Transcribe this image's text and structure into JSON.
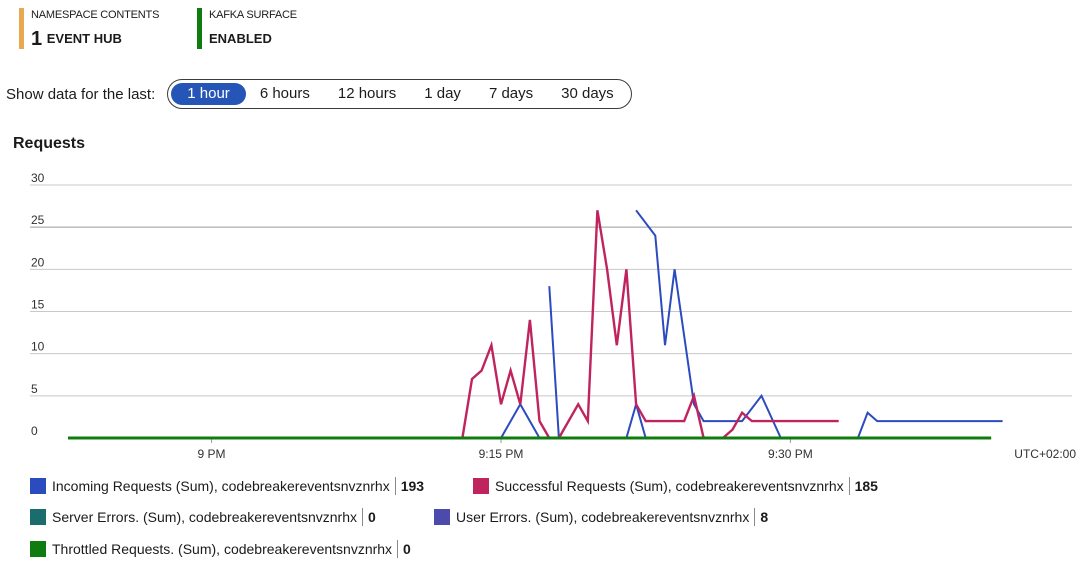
{
  "tiles": [
    {
      "label": "NAMESPACE CONTENTS",
      "number": "1",
      "value": "EVENT HUB",
      "color": "#e8a952"
    },
    {
      "label": "KAFKA SURFACE",
      "number": "",
      "value": "ENABLED",
      "color": "#107c10"
    }
  ],
  "range": {
    "label": "Show data for the last:",
    "options": [
      "1 hour",
      "6 hours",
      "12 hours",
      "1 day",
      "7 days",
      "30 days"
    ],
    "selected": "1 hour"
  },
  "chart_data": {
    "type": "line",
    "title": "Requests",
    "ylim": [
      0,
      30
    ],
    "yticks": [
      0,
      5,
      10,
      15,
      20,
      25,
      30
    ],
    "xlim": [
      8.876,
      9.713
    ],
    "xticks": [
      {
        "at": 9.0,
        "label": "9 PM"
      },
      {
        "at": 9.25,
        "label": "9:15 PM"
      },
      {
        "at": 9.5,
        "label": "9:30 PM"
      }
    ],
    "timezone_label": "UTC+02:00",
    "grid": true,
    "legend_position": "bottom",
    "series": [
      {
        "name": "Incoming Requests (Sum), codebreakereventsnvznrhx",
        "total": "193",
        "color": "#2c4bbf",
        "segments": [
          [
            [
              9.25,
              0
            ],
            [
              9.2667,
              4
            ],
            [
              9.2833,
              0
            ]
          ],
          [
            [
              9.2917,
              18
            ],
            [
              9.3,
              0
            ]
          ],
          [
            [
              9.3667,
              27
            ],
            [
              9.3833,
              24
            ],
            [
              9.3917,
              11
            ],
            [
              9.4,
              20
            ],
            [
              9.4167,
              4
            ],
            [
              9.425,
              2
            ],
            [
              9.4583,
              2
            ],
            [
              9.475,
              5
            ],
            [
              9.4917,
              0
            ]
          ],
          [
            [
              9.5583,
              0
            ],
            [
              9.5667,
              3
            ],
            [
              9.575,
              2
            ],
            [
              9.6833,
              2
            ]
          ],
          [
            [
              9.3583,
              0
            ],
            [
              9.3667,
              4
            ],
            [
              9.375,
              0
            ]
          ]
        ]
      },
      {
        "name": "Successful Requests (Sum), codebreakereventsnvznrhx",
        "total": "185",
        "color": "#c0245e",
        "segments": [
          [
            [
              9.2167,
              0
            ],
            [
              9.225,
              7
            ],
            [
              9.2333,
              8
            ],
            [
              9.2417,
              11
            ],
            [
              9.25,
              4
            ],
            [
              9.2583,
              8
            ],
            [
              9.2667,
              4
            ],
            [
              9.275,
              14
            ],
            [
              9.2833,
              2
            ],
            [
              9.2917,
              0
            ],
            [
              9.3,
              0
            ],
            [
              9.3167,
              4
            ],
            [
              9.325,
              2
            ],
            [
              9.3333,
              27
            ],
            [
              9.3417,
              20
            ],
            [
              9.35,
              11
            ],
            [
              9.3583,
              20
            ],
            [
              9.3667,
              4
            ],
            [
              9.375,
              2
            ],
            [
              9.4083,
              2
            ],
            [
              9.4167,
              5
            ],
            [
              9.425,
              0
            ]
          ],
          [
            [
              9.4417,
              0
            ],
            [
              9.45,
              1
            ],
            [
              9.4583,
              3
            ],
            [
              9.4667,
              2
            ],
            [
              9.5417,
              2
            ]
          ]
        ]
      },
      {
        "name": "Server Errors. (Sum), codebreakereventsnvznrhx",
        "total": "0",
        "color": "#1b6d6d",
        "segments": []
      },
      {
        "name": "User Errors. (Sum), codebreakereventsnvznrhx",
        "total": "8",
        "color": "#4c4bac",
        "segments": []
      },
      {
        "name": "Throttled Requests. (Sum), codebreakereventsnvznrhx",
        "total": "0",
        "color": "#107c10",
        "segments": []
      }
    ]
  }
}
